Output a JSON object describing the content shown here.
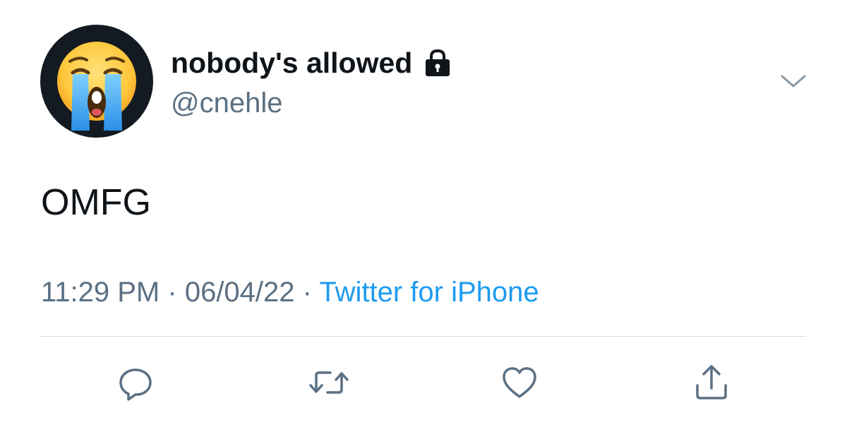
{
  "tweet": {
    "author": {
      "display_name": "nobody's allowed",
      "handle": "@cnehle",
      "avatar_icon": "loudly-crying-face-emoji",
      "protected_icon": "lock-icon"
    },
    "text": "OMFG",
    "time": "11:29 PM",
    "separator": "·",
    "date": "06/04/22",
    "source": "Twitter for iPhone",
    "menu_icon": "chevron-down-icon"
  },
  "actions": [
    {
      "name": "reply",
      "icon": "reply-icon"
    },
    {
      "name": "retweet",
      "icon": "retweet-icon"
    },
    {
      "name": "like",
      "icon": "heart-icon"
    },
    {
      "name": "share",
      "icon": "share-icon"
    }
  ],
  "colors": {
    "text": "#0f1419",
    "secondary": "#5b7083",
    "link": "#1d9bf0",
    "divider": "#cfd9de",
    "avatar_bg": "#141a22"
  }
}
